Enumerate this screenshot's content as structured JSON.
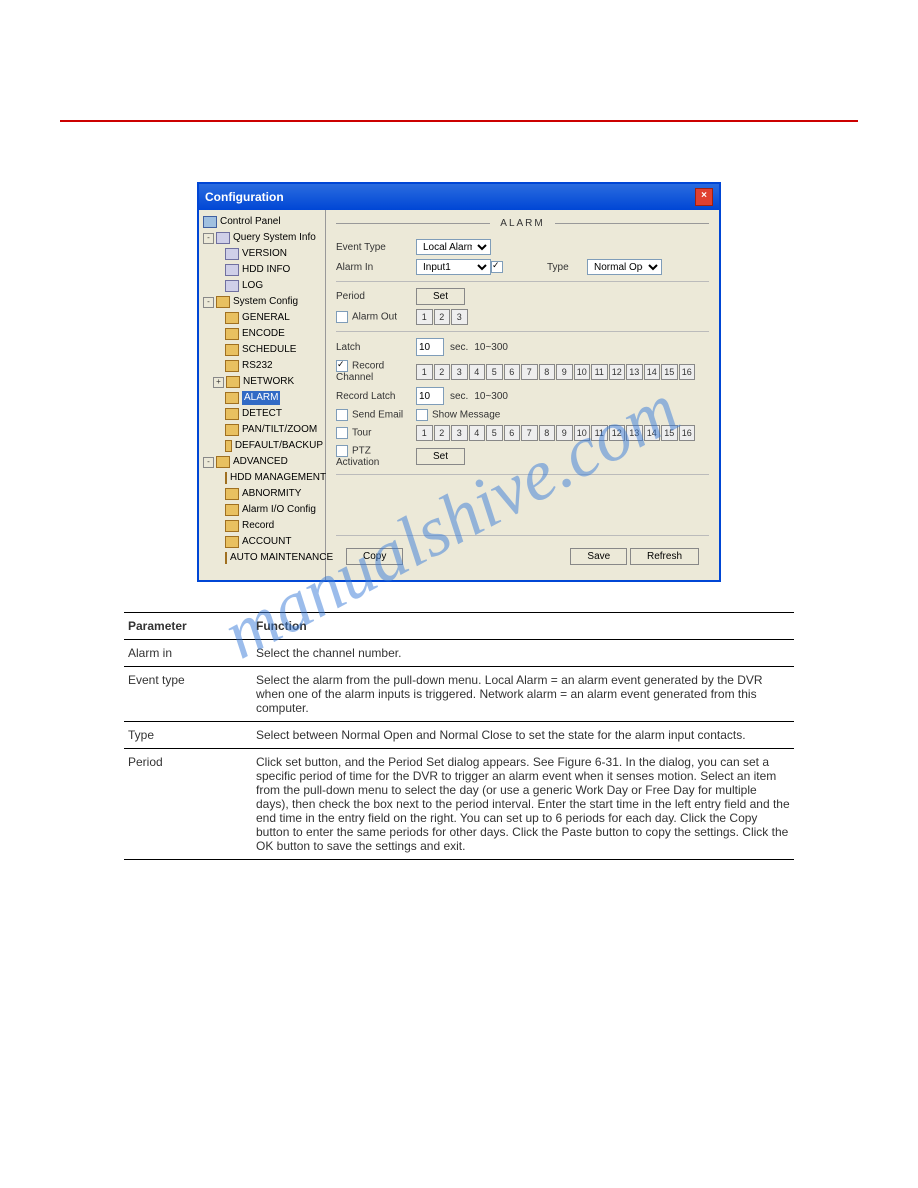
{
  "watermark": "manualshive.com",
  "window": {
    "title": "Configuration",
    "tree": {
      "root": "Control Panel",
      "g1": {
        "name": "Query System Info",
        "items": [
          "VERSION",
          "HDD INFO",
          "LOG"
        ]
      },
      "g2": {
        "name": "System Config",
        "items": [
          "GENERAL",
          "ENCODE",
          "SCHEDULE",
          "RS232",
          "NETWORK",
          "ALARM",
          "DETECT",
          "PAN/TILT/ZOOM",
          "DEFAULT/BACKUP"
        ],
        "selected": "ALARM"
      },
      "g3": {
        "name": "ADVANCED",
        "items": [
          "HDD MANAGEMENT",
          "ABNORMITY",
          "Alarm I/O Config",
          "Record",
          "ACCOUNT",
          "AUTO MAINTENANCE"
        ]
      }
    },
    "header": "ALARM",
    "labels": {
      "event_type": "Event Type",
      "alarm_in": "Alarm In",
      "type": "Type",
      "period": "Period",
      "alarm_out": "Alarm Out",
      "latch": "Latch",
      "record_channel": "Record Channel",
      "record_latch": "Record Latch",
      "send_email": "Send Email",
      "show_message": "Show Message",
      "tour": "Tour",
      "ptz_activation": "PTZ Activation"
    },
    "values": {
      "event_type": "Local Alarm",
      "alarm_in": "Input1",
      "type": "Normal Open",
      "latch": "10",
      "latch_unit": "sec.",
      "latch_range": "10~300",
      "record_latch": "10",
      "record_latch_unit": "sec.",
      "record_latch_range": "10~300",
      "set": "Set"
    },
    "alarm_out": [
      "1",
      "2",
      "3"
    ],
    "channels": [
      "1",
      "2",
      "3",
      "4",
      "5",
      "6",
      "7",
      "8",
      "9",
      "10",
      "11",
      "12",
      "13",
      "14",
      "15",
      "16"
    ],
    "buttons": {
      "copy": "Copy",
      "save": "Save",
      "refresh": "Refresh"
    }
  },
  "table": {
    "h1": "Parameter",
    "h2": "Function",
    "rows": [
      {
        "p": "Alarm in",
        "f": "Select the channel number."
      },
      {
        "p": "Event type",
        "f": "Select the alarm from the pull-down menu. Local Alarm = an alarm event generated by the DVR when one of the alarm inputs is triggered. Network alarm = an alarm event generated from this computer."
      },
      {
        "p": "Type",
        "f": "Select between Normal Open and Normal Close to set the state for the alarm input contacts."
      },
      {
        "p": "Period",
        "f": "Click set button, and the Period Set dialog appears. See Figure 6-31. In the dialog, you can set a specific period of time for the DVR to trigger an alarm event when it senses motion. Select an item from the pull-down menu to select the day (or use a generic Work Day or Free Day for multiple days), then check the box next to the period interval. Enter the start time in the left entry field and the end time in the entry field on the right. You can set up to 6 periods for each day. Click the Copy button to enter the same periods for other days. Click the Paste button to copy the settings. Click the OK button to save the settings and exit."
      }
    ]
  }
}
